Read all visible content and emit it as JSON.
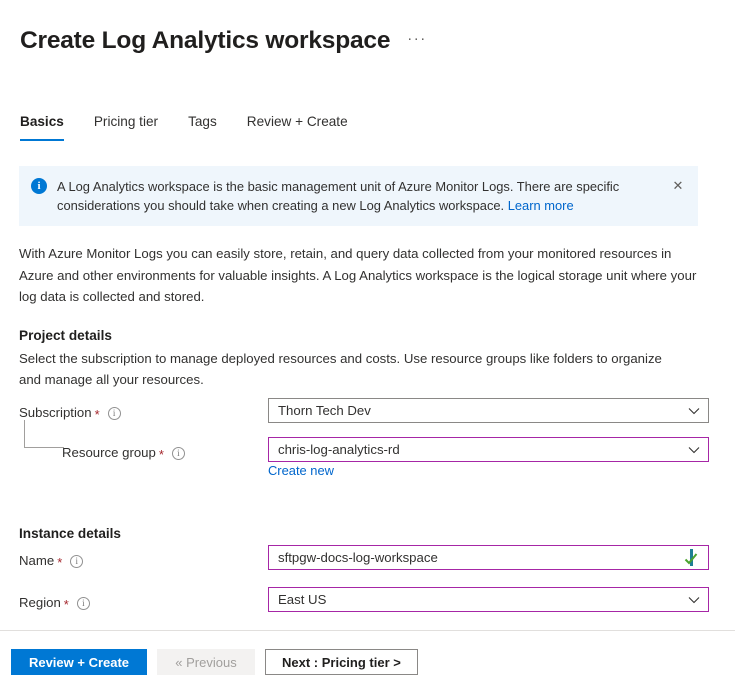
{
  "header": {
    "title": "Create Log Analytics workspace",
    "more_menu": "···"
  },
  "tabs": [
    {
      "label": "Basics",
      "active": true
    },
    {
      "label": "Pricing tier",
      "active": false
    },
    {
      "label": "Tags",
      "active": false
    },
    {
      "label": "Review + Create",
      "active": false
    }
  ],
  "banner": {
    "icon": "info-icon",
    "text": "A Log Analytics workspace is the basic management unit of Azure Monitor Logs. There are specific considerations you should take when creating a new Log Analytics workspace. ",
    "link_label": "Learn more",
    "close_label": "✕",
    "background_color": "#eff6fc",
    "accent_color": "#0078d4"
  },
  "description": "With Azure Monitor Logs you can easily store, retain, and query data collected from your monitored resources in Azure and other environments for valuable insights. A Log Analytics workspace is the logical storage unit where your log data is collected and stored.",
  "project_details": {
    "heading": "Project details",
    "subtext": "Select the subscription to manage deployed resources and costs. Use resource groups like folders to organize and manage all your resources.",
    "subscription": {
      "label": "Subscription",
      "required_marker": "*",
      "info": "ⓘ",
      "value": "Thorn Tech Dev",
      "border_color": "#8a8886"
    },
    "resource_group": {
      "label": "Resource group",
      "required_marker": "*",
      "info": "ⓘ",
      "value": "chris-log-analytics-rd",
      "border_color": "#a626a6",
      "create_new_label": "Create new"
    }
  },
  "instance_details": {
    "heading": "Instance details",
    "name": {
      "label": "Name",
      "required_marker": "*",
      "info": "ⓘ",
      "value": "sftpgw-docs-log-workspace",
      "border_color": "#a626a6",
      "validation_state": "valid"
    },
    "region": {
      "label": "Region",
      "required_marker": "*",
      "info": "ⓘ",
      "value": "East US",
      "border_color": "#a626a6"
    }
  },
  "footer": {
    "review_create_label": "Review + Create",
    "previous_label": "« Previous",
    "next_label": "Next : Pricing tier >",
    "primary_color": "#0078d4"
  }
}
